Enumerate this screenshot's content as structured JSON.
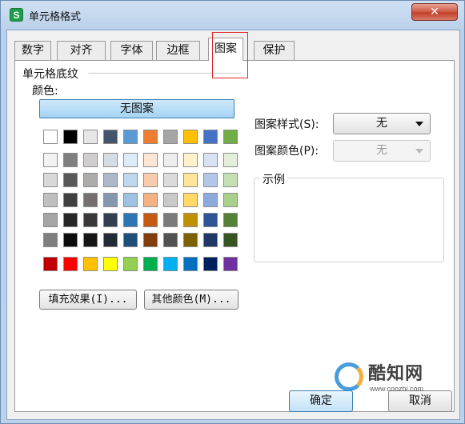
{
  "window": {
    "title": "单元格格式",
    "app_icon_glyph": "S",
    "close_glyph": "✕"
  },
  "tabs": [
    {
      "label": "数字"
    },
    {
      "label": "对齐"
    },
    {
      "label": "字体"
    },
    {
      "label": "边框"
    },
    {
      "label": "图案",
      "active": true
    },
    {
      "label": "保护"
    }
  ],
  "shading": {
    "group_title": "单元格底纹",
    "color_label": "颜色:",
    "no_pattern_button": "无图案",
    "fill_effects_button": "填充效果(I)...",
    "more_colors_button": "其他颜色(M)..."
  },
  "pattern": {
    "style_label": "图案样式(S):",
    "style_value": "无",
    "color_label": "图案颜色(P):",
    "color_value": "无"
  },
  "sample": {
    "label": "示例"
  },
  "buttons": {
    "ok": "确定",
    "cancel": "取消"
  },
  "palette": {
    "top_row": [
      "#ffffff",
      "#000000",
      "#e7e6e6",
      "#44546a",
      "#5b9bd5",
      "#ed7d31",
      "#a5a5a5",
      "#ffc000",
      "#4472c4",
      "#70ad47"
    ],
    "tint_rows": [
      [
        "#f2f2f2",
        "#7f7f7f",
        "#d0cece",
        "#d6dce4",
        "#deebf6",
        "#fbe5d5",
        "#ededed",
        "#fff2cc",
        "#d9e2f3",
        "#e2efd9"
      ],
      [
        "#d8d8d8",
        "#595959",
        "#aeabab",
        "#adb9ca",
        "#bdd7ee",
        "#f7cbac",
        "#dbdbdb",
        "#fee599",
        "#b4c6e7",
        "#c5e0b3"
      ],
      [
        "#bfbfbf",
        "#3f3f3f",
        "#757070",
        "#8496b0",
        "#9cc3e5",
        "#f4b183",
        "#c9c9c9",
        "#ffd965",
        "#8eaadb",
        "#a8d08d"
      ],
      [
        "#a5a5a5",
        "#262626",
        "#3a3838",
        "#323f4f",
        "#2e75b5",
        "#c55a11",
        "#7b7b7b",
        "#bf9000",
        "#2f5496",
        "#538135"
      ],
      [
        "#7f7f7f",
        "#0c0c0c",
        "#161616",
        "#222a35",
        "#1e4e79",
        "#833c0b",
        "#525252",
        "#7f6000",
        "#1f3864",
        "#375623"
      ]
    ],
    "standard_row": [
      "#c00000",
      "#ff0000",
      "#ffc000",
      "#ffff00",
      "#92d050",
      "#00b050",
      "#00b0f0",
      "#0070c0",
      "#002060",
      "#7030a0"
    ]
  },
  "watermark": {
    "name": "酷知网",
    "url": "www.coozhi.com"
  }
}
